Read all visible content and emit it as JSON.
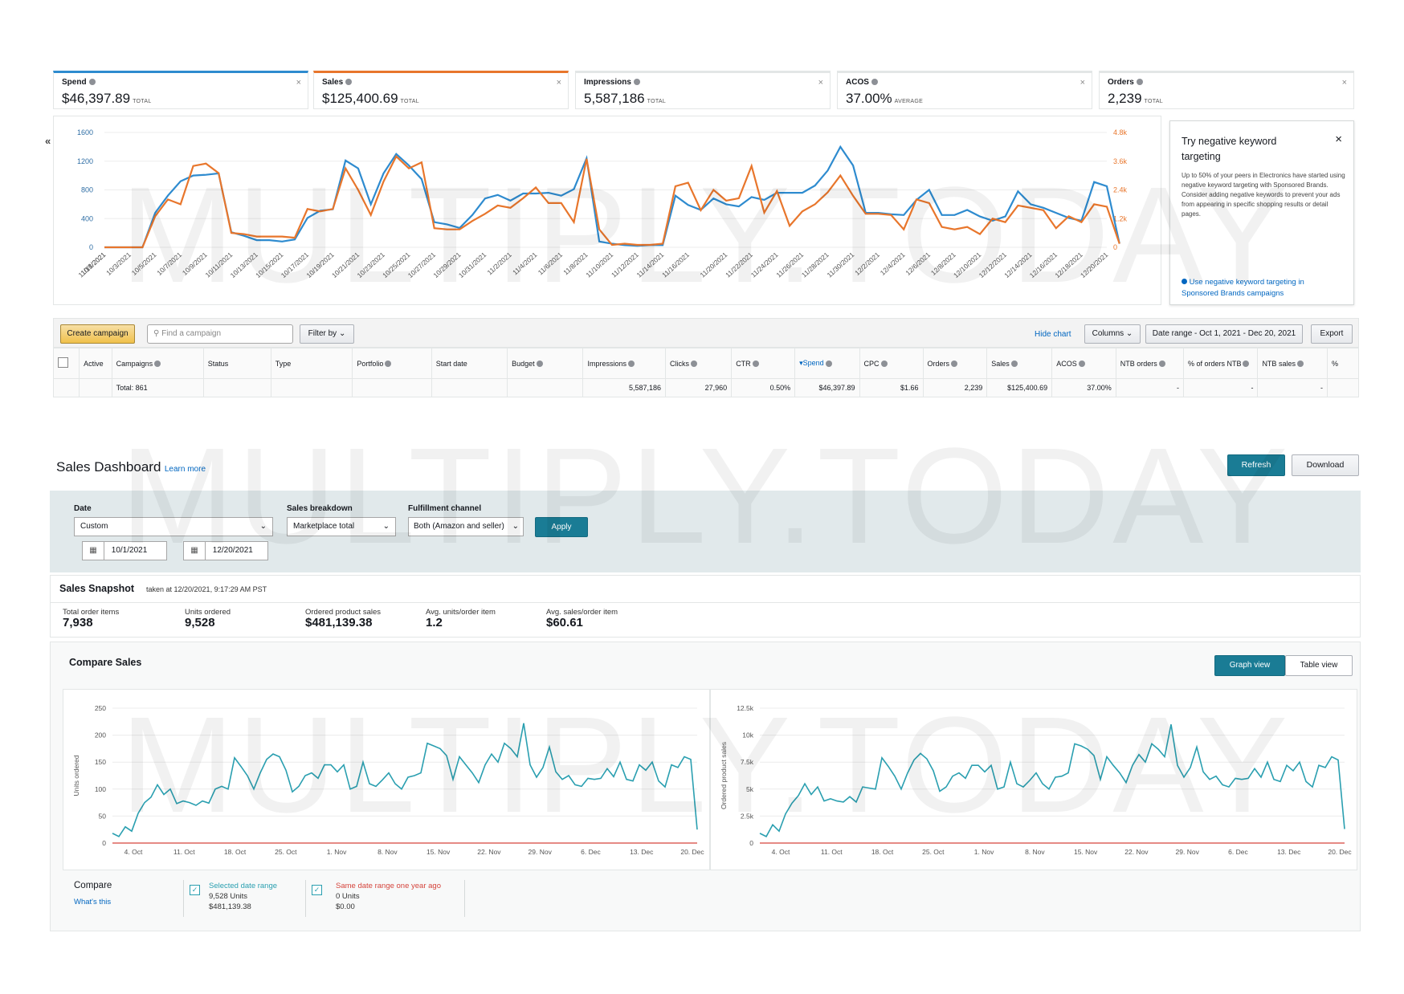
{
  "watermark": "MULTIPLY.TODAY",
  "metrics": [
    {
      "label": "Spend",
      "value": "$46,397.89",
      "agg": "TOTAL",
      "color": "#2e8bcf"
    },
    {
      "label": "Sales",
      "value": "$125,400.69",
      "agg": "TOTAL",
      "color": "#e8762c"
    },
    {
      "label": "Impressions",
      "value": "5,587,186",
      "agg": "TOTAL",
      "color": ""
    },
    {
      "label": "ACOS",
      "value": "37.00%",
      "agg": "AVERAGE",
      "color": ""
    },
    {
      "label": "Orders",
      "value": "2,239",
      "agg": "TOTAL",
      "color": ""
    }
  ],
  "close_glyph": "×",
  "collapse_glyph": "«",
  "chart_data": [
    {
      "type": "line",
      "x": [
        "10/1/2021",
        "10/2/2021",
        "10/3/2021",
        "10/4/2021",
        "10/5/2021",
        "10/6/2021",
        "10/7/2021",
        "10/8/2021",
        "10/9/2021",
        "10/10/2021",
        "10/11/2021",
        "10/12/2021",
        "10/13/2021",
        "10/14/2021",
        "10/15/2021",
        "10/16/2021",
        "10/17/2021",
        "10/18/2021",
        "10/19/2021",
        "10/20/2021",
        "10/21/2021",
        "10/22/2021",
        "10/23/2021",
        "10/24/2021",
        "10/25/2021",
        "10/26/2021",
        "10/27/2021",
        "10/28/2021",
        "10/29/2021",
        "10/30/2021",
        "10/31/2021",
        "11/1/2021",
        "11/2/2021",
        "11/3/2021",
        "11/4/2021",
        "11/5/2021",
        "11/6/2021",
        "11/7/2021",
        "11/8/2021",
        "11/9/2021",
        "11/10/2021",
        "11/11/2021",
        "11/12/2021",
        "11/13/2021",
        "11/14/2021",
        "11/15/2021",
        "11/16/2021",
        "11/17/2021",
        "11/19/2021",
        "11/20/2021",
        "11/21/2021",
        "11/22/2021",
        "11/23/2021",
        "11/24/2021",
        "11/25/2021",
        "11/26/2021",
        "11/27/2021",
        "11/28/2021",
        "11/29/2021",
        "11/30/2021",
        "12/1/2021",
        "12/2/2021",
        "12/3/2021",
        "12/4/2021",
        "12/5/2021",
        "12/6/2021",
        "12/7/2021",
        "12/8/2021",
        "12/9/2021",
        "12/10/2021",
        "12/11/2021",
        "12/12/2021",
        "12/13/2021",
        "12/14/2021",
        "12/15/2021",
        "12/16/2021",
        "12/17/2021",
        "12/18/2021",
        "12/19/2021",
        "12/20/2021"
      ],
      "tick_labels": [
        "10/1/2021",
        "10/3/2021",
        "10/5/2021",
        "10/7/2021",
        "10/9/2021",
        "10/11/2021",
        "10/13/2021",
        "10/15/2021",
        "10/17/2021",
        "10/19/2021",
        "10/21/2021",
        "10/23/2021",
        "10/25/2021",
        "10/27/2021",
        "10/29/2021",
        "10/31/2021",
        "11/2/2021",
        "11/4/2021",
        "11/6/2021",
        "11/8/2021",
        "11/10/2021",
        "11/12/2021",
        "11/14/2021",
        "11/16/2021",
        "11/18/2021",
        "11/20/2021",
        "11/22/2021",
        "11/24/2021",
        "11/26/2021",
        "11/28/2021",
        "11/30/2021",
        "12/2/2021",
        "12/4/2021",
        "12/6/2021",
        "12/8/2021",
        "12/10/2021",
        "12/12/2021",
        "12/14/2021",
        "12/16/2021",
        "12/18/2021",
        "12/20/2021"
      ],
      "y_left_ticks": [
        "0",
        "400",
        "800",
        "1200",
        "1600"
      ],
      "y_right_ticks": [
        "0",
        "1.2k",
        "2.4k",
        "3.6k",
        "4.8k"
      ],
      "ylim_left": [
        0,
        1600
      ],
      "ylim_right": [
        0,
        4800
      ],
      "series": [
        {
          "color": "#2e8bcf",
          "axis": "left",
          "values": [
            0,
            0,
            0,
            0,
            480,
            720,
            920,
            1000,
            1010,
            1030,
            210,
            160,
            100,
            100,
            80,
            110,
            410,
            510,
            530,
            1210,
            1100,
            600,
            1030,
            1300,
            1140,
            950,
            350,
            320,
            270,
            450,
            680,
            730,
            650,
            750,
            750,
            760,
            720,
            810,
            1240,
            80,
            50,
            30,
            20,
            30,
            30,
            720,
            590,
            520,
            680,
            600,
            570,
            700,
            660,
            760,
            760,
            760,
            860,
            1070,
            1400,
            1140,
            480,
            480,
            460,
            450,
            660,
            800,
            450,
            450,
            520,
            430,
            370,
            430,
            780,
            600,
            550,
            480,
            410,
            370,
            910,
            850,
            50
          ]
        },
        {
          "color": "#e8762c",
          "axis": "right",
          "values": [
            0,
            0,
            0,
            0,
            1300,
            2000,
            1800,
            3400,
            3500,
            3100,
            600,
            550,
            450,
            450,
            450,
            400,
            1600,
            1500,
            1600,
            3300,
            2400,
            1350,
            2750,
            3800,
            3300,
            3550,
            800,
            750,
            750,
            1100,
            1400,
            1750,
            1650,
            2050,
            2500,
            1850,
            1850,
            1050,
            3700,
            750,
            100,
            150,
            100,
            100,
            150,
            2550,
            2700,
            1550,
            2400,
            1950,
            2050,
            3400,
            1450,
            2350,
            900,
            1500,
            1800,
            2300,
            3000,
            2150,
            1400,
            1400,
            1350,
            750,
            2000,
            1850,
            850,
            750,
            850,
            550,
            1200,
            1050,
            1750,
            1650,
            1550,
            800,
            1300,
            1050,
            1800,
            1700,
            150
          ]
        }
      ]
    },
    {
      "type": "line",
      "ylabel": "Units ordered",
      "y_ticks": [
        "0",
        "50",
        "100",
        "150",
        "200",
        "250"
      ],
      "ylim": [
        0,
        250
      ],
      "x_ticks": [
        "4. Oct",
        "11. Oct",
        "18. Oct",
        "25. Oct",
        "1. Nov",
        "8. Nov",
        "15. Nov",
        "22. Nov",
        "29. Nov",
        "6. Dec",
        "13. Dec",
        "20. Dec"
      ],
      "series": [
        {
          "color": "#2a9fb0",
          "values": [
            18,
            12,
            30,
            22,
            55,
            75,
            85,
            108,
            90,
            100,
            73,
            78,
            75,
            70,
            78,
            74,
            100,
            105,
            100,
            158,
            142,
            125,
            100,
            130,
            155,
            165,
            160,
            135,
            95,
            105,
            125,
            130,
            120,
            145,
            145,
            132,
            145,
            100,
            105,
            150,
            110,
            105,
            117,
            130,
            110,
            100,
            122,
            125,
            130,
            185,
            180,
            175,
            162,
            118,
            160,
            145,
            130,
            112,
            145,
            165,
            150,
            185,
            175,
            160,
            222,
            145,
            122,
            140,
            178,
            132,
            118,
            125,
            108,
            105,
            120,
            118,
            120,
            138,
            123,
            150,
            118,
            115,
            145,
            135,
            150,
            115,
            104,
            145,
            140,
            160,
            155,
            25
          ]
        },
        {
          "color": "#d5443c",
          "values": [
            0,
            0,
            0,
            0,
            0,
            0,
            0,
            0,
            0,
            0,
            0,
            0,
            0,
            0,
            0,
            0,
            0,
            0,
            0,
            0,
            0,
            0,
            0,
            0,
            0,
            0,
            0,
            0,
            0,
            0,
            0,
            0,
            0,
            0,
            0,
            0,
            0,
            0,
            0,
            0,
            0,
            0,
            0,
            0,
            0,
            0,
            0,
            0,
            0,
            0,
            0,
            0,
            0,
            0,
            0,
            0,
            0,
            0,
            0,
            0,
            0,
            0,
            0,
            0,
            0,
            0,
            0,
            0,
            0,
            0,
            0,
            0,
            0,
            0,
            0,
            0,
            0,
            0,
            0,
            0,
            0,
            0,
            0,
            0,
            0,
            0,
            0,
            0,
            0,
            0,
            0,
            0
          ]
        }
      ]
    },
    {
      "type": "line",
      "ylabel": "Ordered product sales",
      "y_ticks": [
        "0",
        "2.5k",
        "5k",
        "7.5k",
        "10k",
        "12.5k"
      ],
      "ylim": [
        0,
        12500
      ],
      "x_ticks": [
        "4. Oct",
        "11. Oct",
        "18. Oct",
        "25. Oct",
        "1. Nov",
        "8. Nov",
        "15. Nov",
        "22. Nov",
        "29. Nov",
        "6. Dec",
        "13. Dec",
        "20. Dec"
      ],
      "series": [
        {
          "color": "#2a9fb0",
          "values": [
            900,
            600,
            1700,
            1100,
            2700,
            3700,
            4400,
            5500,
            4500,
            5200,
            3900,
            4100,
            3900,
            3800,
            4300,
            3800,
            5200,
            5100,
            5000,
            7900,
            7100,
            6200,
            5000,
            6500,
            7700,
            8300,
            7800,
            6700,
            4800,
            5200,
            6200,
            6500,
            6000,
            7200,
            7200,
            6600,
            7200,
            5000,
            5200,
            7500,
            5500,
            5200,
            5800,
            6500,
            5500,
            5000,
            6100,
            6200,
            6500,
            9200,
            9000,
            8700,
            8100,
            5900,
            8000,
            7200,
            6500,
            5600,
            7200,
            8200,
            7500,
            9200,
            8700,
            8000,
            11000,
            7200,
            6100,
            7000,
            8900,
            6600,
            5900,
            6200,
            5400,
            5200,
            6000,
            5900,
            6000,
            6900,
            6100,
            7500,
            5900,
            5700,
            7200,
            6700,
            7500,
            5700,
            5200,
            7200,
            7000,
            8000,
            7700,
            1300
          ]
        },
        {
          "color": "#d5443c",
          "values": [
            0,
            0,
            0,
            0,
            0,
            0,
            0,
            0,
            0,
            0,
            0,
            0,
            0,
            0,
            0,
            0,
            0,
            0,
            0,
            0,
            0,
            0,
            0,
            0,
            0,
            0,
            0,
            0,
            0,
            0,
            0,
            0,
            0,
            0,
            0,
            0,
            0,
            0,
            0,
            0,
            0,
            0,
            0,
            0,
            0,
            0,
            0,
            0,
            0,
            0,
            0,
            0,
            0,
            0,
            0,
            0,
            0,
            0,
            0,
            0,
            0,
            0,
            0,
            0,
            0,
            0,
            0,
            0,
            0,
            0,
            0,
            0,
            0,
            0,
            0,
            0,
            0,
            0,
            0,
            0,
            0,
            0,
            0,
            0,
            0,
            0,
            0,
            0,
            0,
            0,
            0,
            0
          ]
        }
      ]
    }
  ],
  "tip": {
    "title": "Try negative keyword targeting",
    "body": "Up to 50% of your peers in Electronics have started using negative keyword targeting with Sponsored Brands. Consider adding negative keywords to prevent your ads from appearing in specific shopping results or detail pages.",
    "link": "Use negative keyword targeting in Sponsored Brands campaigns"
  },
  "toolbar": {
    "create": "Create campaign",
    "search_placeholder": "Find a campaign",
    "filter": "Filter by",
    "hide_chart": "Hide chart",
    "columns": "Columns",
    "date_range": "Date range - Oct 1, 2021 - Dec 20, 2021",
    "export": "Export"
  },
  "table": {
    "headers": [
      "Active",
      "Campaigns",
      "Status",
      "Type",
      "Portfolio",
      "Start date",
      "Budget",
      "Impressions",
      "Clicks",
      "CTR",
      "Spend",
      "CPC",
      "Orders",
      "Sales",
      "ACOS",
      "NTB orders",
      "% of orders NTB",
      "NTB sales",
      "%"
    ],
    "total": [
      "",
      "Total: 861",
      "",
      "",
      "",
      "",
      "",
      "5,587,186",
      "27,960",
      "0.50%",
      "$46,397.89",
      "$1.66",
      "2,239",
      "$125,400.69",
      "37.00%",
      "-",
      "-",
      "-",
      ""
    ]
  },
  "dashboard": {
    "title": "Sales Dashboard",
    "learn_more": "Learn more",
    "refresh": "Refresh",
    "download": "Download",
    "date_label": "Date",
    "date_value": "Custom",
    "start_date": "10/1/2021",
    "end_date": "12/20/2021",
    "breakdown_label": "Sales breakdown",
    "breakdown_value": "Marketplace total",
    "channel_label": "Fulfillment channel",
    "channel_value": "Both (Amazon and seller)",
    "apply": "Apply"
  },
  "snapshot": {
    "title": "Sales Snapshot",
    "taken": "taken at 12/20/2021, 9:17:29 AM PST",
    "items": [
      {
        "label": "Total order items",
        "value": "7,938"
      },
      {
        "label": "Units ordered",
        "value": "9,528"
      },
      {
        "label": "Ordered product sales",
        "value": "$481,139.38"
      },
      {
        "label": "Avg. units/order item",
        "value": "1.2"
      },
      {
        "label": "Avg. sales/order item",
        "value": "$60.61"
      }
    ]
  },
  "compare": {
    "title": "Compare Sales",
    "graph_view": "Graph view",
    "table_view": "Table view",
    "compare_label": "Compare",
    "whats_this": "What's this",
    "sel_title": "Selected date range",
    "sel_units": "9,528 Units",
    "sel_sales": "$481,139.38",
    "ago_title": "Same date range one year ago",
    "ago_units": "0 Units",
    "ago_sales": "$0.00"
  }
}
